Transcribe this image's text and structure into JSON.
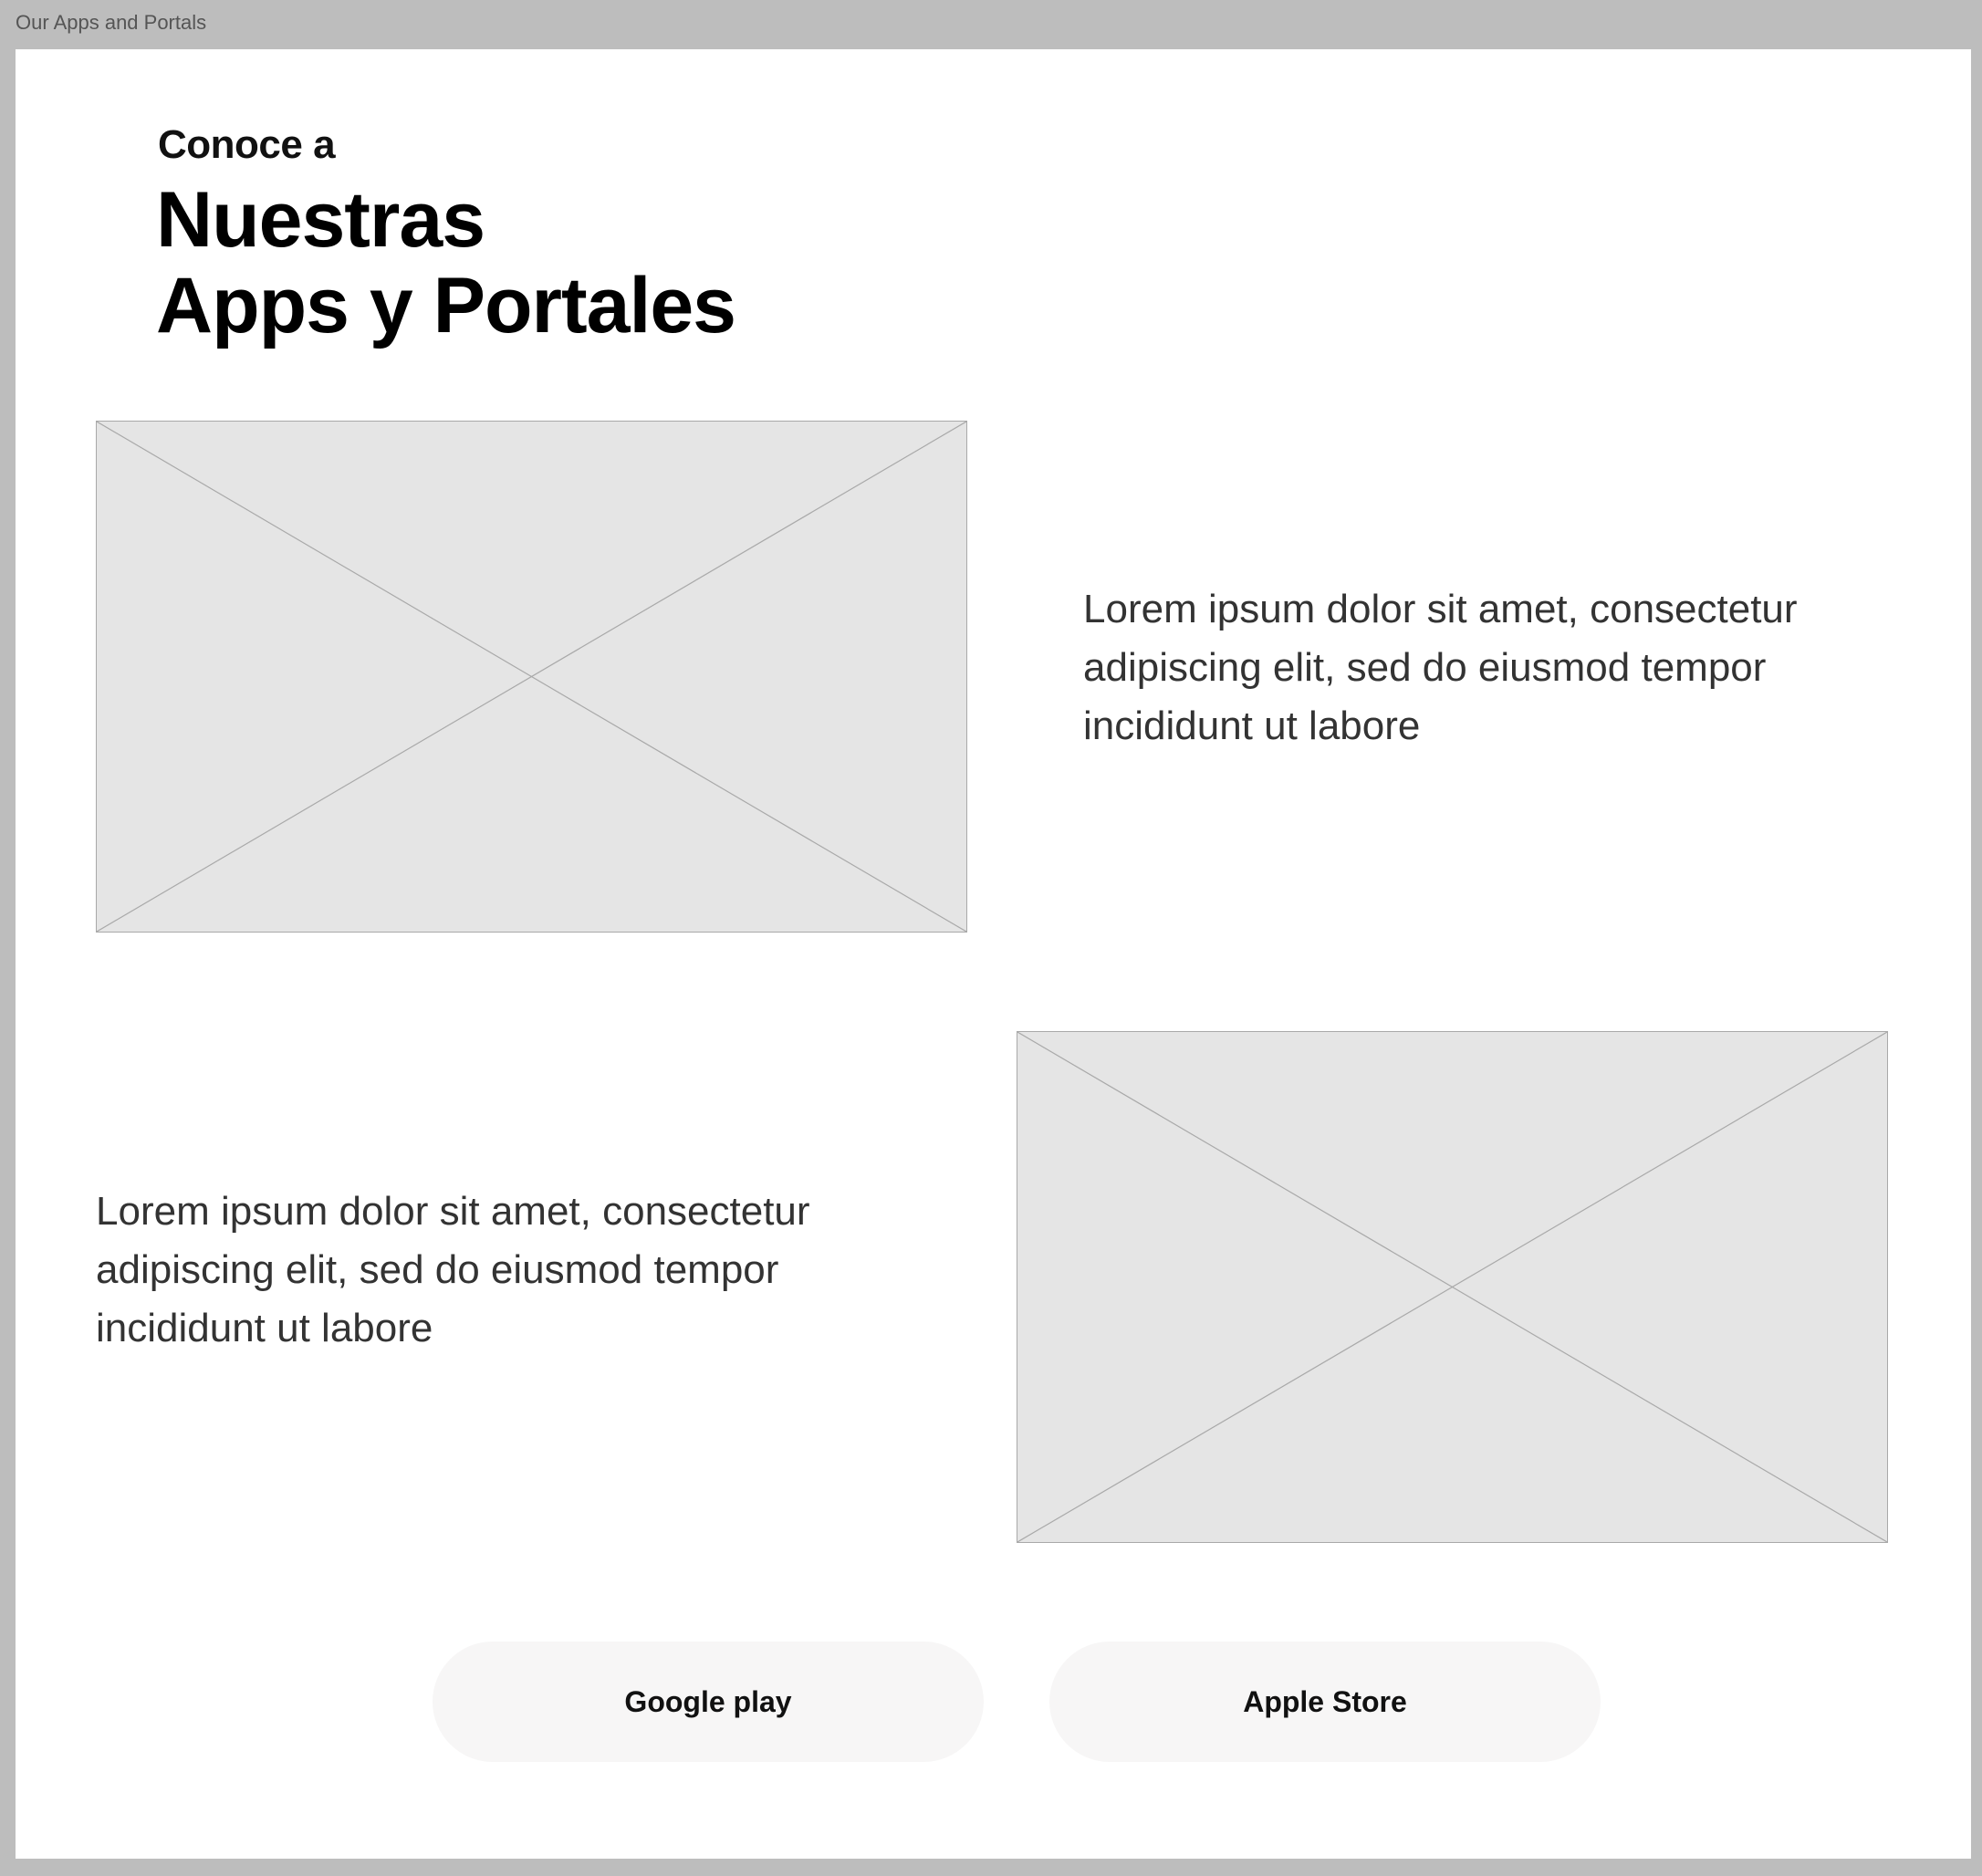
{
  "frame": {
    "title": "Our Apps and Portals"
  },
  "hero": {
    "eyebrow": "Conoce a",
    "headline_line1": "Nuestras",
    "headline_line2": "Apps y Portales"
  },
  "sections": [
    {
      "image": "image-placeholder-icon",
      "text": "Lorem ipsum dolor sit amet, consectetur adipiscing elit, sed do eiusmod tempor incididunt ut labore"
    },
    {
      "image": "image-placeholder-icon",
      "text": "Lorem ipsum dolor sit amet, consectetur adipiscing elit, sed do eiusmod tempor incididunt ut labore"
    }
  ],
  "buttons": {
    "google_label": "Google play",
    "apple_label": "Apple Store"
  },
  "colors": {
    "frame_background": "#bdbdbd",
    "canvas_background": "#ffffff",
    "placeholder_fill": "#e5e5e5",
    "placeholder_stroke": "#a9a9a9",
    "button_background": "#f7f6f6"
  }
}
